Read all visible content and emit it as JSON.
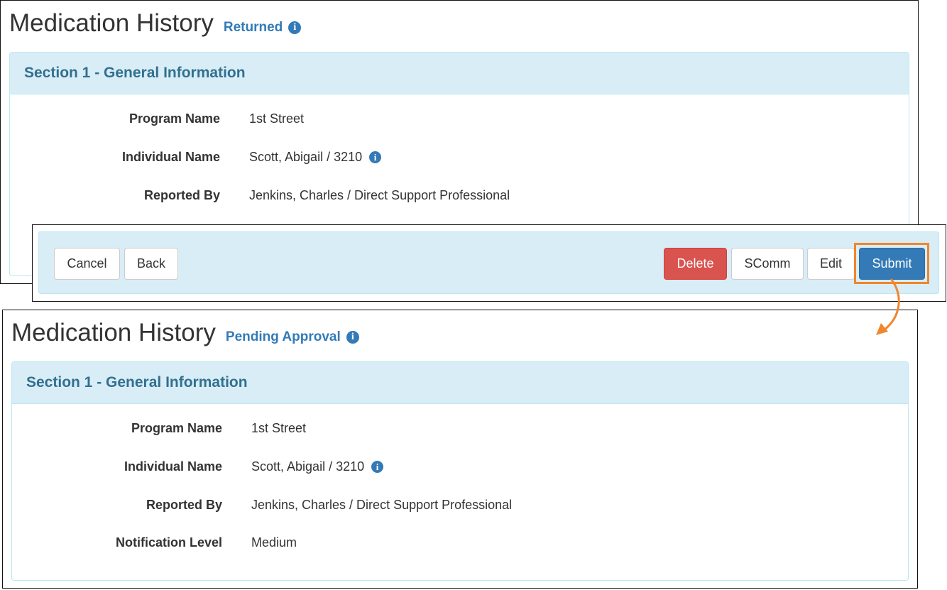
{
  "before": {
    "title": "Medication History",
    "status": "Returned",
    "section_title": "Section 1 - General Information",
    "fields": [
      {
        "label": "Program Name",
        "value": "1st Street"
      },
      {
        "label": "Individual Name",
        "value": "Scott, Abigail / 3210"
      },
      {
        "label": "Reported By",
        "value": "Jenkins, Charles / Direct Support Professional"
      }
    ]
  },
  "footer": {
    "cancel": "Cancel",
    "back": "Back",
    "delete": "Delete",
    "scomm": "SComm",
    "edit": "Edit",
    "submit": "Submit"
  },
  "after": {
    "title": "Medication History",
    "status": "Pending Approval",
    "section_title": "Section 1 - General Information",
    "fields": [
      {
        "label": "Program Name",
        "value": "1st Street"
      },
      {
        "label": "Individual Name",
        "value": "Scott, Abigail / 3210"
      },
      {
        "label": "Reported By",
        "value": "Jenkins, Charles / Direct Support Professional"
      },
      {
        "label": "Notification Level",
        "value": "Medium"
      }
    ]
  },
  "colors": {
    "status_link": "#337ab7",
    "panel_heading_bg": "#d9edf7",
    "panel_heading_text": "#31708f",
    "delete_button": "#d9534f",
    "submit_button": "#337ab7",
    "callout_highlight": "#f0862d"
  },
  "icons": {
    "info": "info-circle-icon",
    "callout": "curved-arrow-icon"
  }
}
